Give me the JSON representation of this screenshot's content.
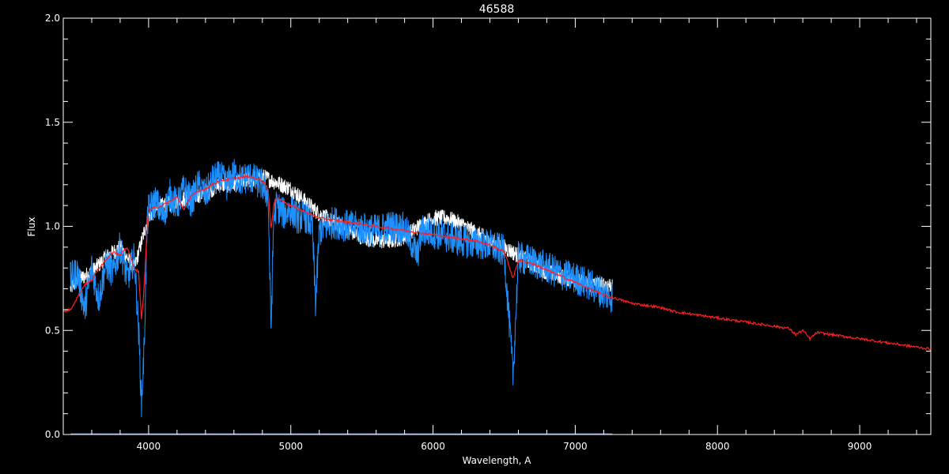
{
  "chart_data": {
    "type": "line",
    "title": "46588",
    "xlabel": "Wavelength, A",
    "ylabel": "Flux",
    "xlim": [
      3400,
      9500
    ],
    "ylim": [
      0.0,
      2.0
    ],
    "x_ticks": [
      4000,
      5000,
      6000,
      7000,
      8000,
      9000
    ],
    "x_tick_labels": [
      "4000",
      "5000",
      "6000",
      "7000",
      "8000",
      "9000"
    ],
    "y_ticks": [
      0.0,
      0.5,
      1.0,
      1.5,
      2.0
    ],
    "y_tick_labels": [
      "0.0",
      "0.5",
      "1.0",
      "1.5",
      "2.0"
    ],
    "grid": false,
    "legend": "none",
    "background": "#000000",
    "axis_color": "#ffffff",
    "series": [
      {
        "color": "#ffffff",
        "noise": 0.04,
        "x": [
          3450,
          3500,
          3600,
          3700,
          3800,
          3900,
          4000,
          4100,
          4200,
          4300,
          4400,
          4500,
          4600,
          4700,
          4800,
          4900,
          5000,
          5100,
          5200,
          5300,
          5400,
          5500,
          5600,
          5700,
          5800,
          5900,
          6000,
          6100,
          6200,
          6300,
          6400,
          6500,
          6600,
          6700,
          6800,
          6900,
          7000,
          7100,
          7200,
          7260
        ],
        "y": [
          0.7,
          0.74,
          0.78,
          0.85,
          0.9,
          0.8,
          1.05,
          1.1,
          1.12,
          1.14,
          1.16,
          1.2,
          1.2,
          1.22,
          1.24,
          1.21,
          1.18,
          1.12,
          1.06,
          1.02,
          0.98,
          0.95,
          0.93,
          0.93,
          0.95,
          1.0,
          1.04,
          1.04,
          1.01,
          0.97,
          0.93,
          0.9,
          0.86,
          0.82,
          0.78,
          0.76,
          0.74,
          0.72,
          0.72,
          0.72
        ]
      },
      {
        "color": "#1e90ff",
        "noise": 0.08,
        "x": [
          3450,
          3500,
          3550,
          3600,
          3650,
          3700,
          3750,
          3800,
          3850,
          3900,
          3930,
          3950,
          3968,
          3990,
          4000,
          4050,
          4100,
          4150,
          4200,
          4250,
          4300,
          4350,
          4400,
          4450,
          4500,
          4550,
          4600,
          4650,
          4700,
          4750,
          4800,
          4840,
          4861,
          4880,
          4900,
          4950,
          5000,
          5050,
          5100,
          5150,
          5175,
          5200,
          5250,
          5300,
          5400,
          5500,
          5600,
          5700,
          5800,
          5890,
          5920,
          6000,
          6100,
          6200,
          6300,
          6400,
          6500,
          6563,
          6600,
          6700,
          6800,
          6900,
          7000,
          7100,
          7150,
          7200,
          7260
        ],
        "y": [
          0.75,
          0.78,
          0.6,
          0.8,
          0.65,
          0.82,
          0.78,
          0.9,
          0.75,
          0.85,
          0.5,
          0.15,
          0.4,
          1.0,
          1.08,
          1.12,
          1.05,
          1.15,
          1.1,
          1.18,
          1.12,
          1.2,
          1.15,
          1.22,
          1.24,
          1.2,
          1.25,
          1.22,
          1.24,
          1.22,
          1.2,
          1.15,
          0.5,
          1.05,
          1.1,
          1.06,
          1.08,
          1.04,
          1.05,
          1.0,
          0.62,
          0.98,
          1.0,
          1.02,
          1.0,
          0.99,
          0.98,
          1.0,
          0.99,
          0.86,
          0.98,
          0.97,
          0.95,
          0.93,
          0.92,
          0.91,
          0.88,
          0.28,
          0.85,
          0.83,
          0.8,
          0.77,
          0.75,
          0.72,
          0.7,
          0.68,
          0.66
        ]
      },
      {
        "color": "#ff2020",
        "noise": 0.006,
        "x": [
          3400,
          3450,
          3500,
          3550,
          3600,
          3650,
          3700,
          3750,
          3800,
          3850,
          3900,
          3930,
          3950,
          3968,
          3990,
          4000,
          4100,
          4200,
          4250,
          4300,
          4400,
          4500,
          4600,
          4700,
          4800,
          4840,
          4861,
          4880,
          4900,
          5000,
          5100,
          5200,
          5300,
          5400,
          5500,
          5600,
          5700,
          5800,
          5900,
          6000,
          6100,
          6200,
          6300,
          6400,
          6500,
          6563,
          6600,
          6700,
          6800,
          6900,
          7000,
          7100,
          7200,
          7300,
          7400,
          7500,
          7600,
          7700,
          7800,
          7900,
          8000,
          8100,
          8200,
          8300,
          8400,
          8500,
          8550,
          8600,
          8650,
          8700,
          8800,
          8900,
          9000,
          9100,
          9200,
          9300,
          9400,
          9500
        ],
        "y": [
          0.59,
          0.6,
          0.66,
          0.72,
          0.74,
          0.8,
          0.84,
          0.88,
          0.86,
          0.9,
          0.8,
          0.78,
          0.55,
          0.7,
          1.0,
          1.08,
          1.1,
          1.14,
          1.08,
          1.15,
          1.18,
          1.22,
          1.23,
          1.24,
          1.22,
          1.18,
          0.98,
          1.1,
          1.14,
          1.1,
          1.07,
          1.04,
          1.03,
          1.02,
          1.01,
          1.0,
          0.99,
          0.98,
          0.97,
          0.96,
          0.95,
          0.94,
          0.93,
          0.91,
          0.88,
          0.75,
          0.84,
          0.82,
          0.79,
          0.76,
          0.73,
          0.7,
          0.67,
          0.65,
          0.63,
          0.62,
          0.61,
          0.59,
          0.58,
          0.57,
          0.56,
          0.55,
          0.54,
          0.53,
          0.52,
          0.51,
          0.48,
          0.5,
          0.46,
          0.49,
          0.48,
          0.47,
          0.46,
          0.45,
          0.44,
          0.43,
          0.42,
          0.41
        ]
      },
      {
        "color": "#6495ed",
        "noise": 0.0,
        "x": [
          3450,
          7260
        ],
        "y": [
          0.003,
          0.003
        ]
      }
    ]
  }
}
